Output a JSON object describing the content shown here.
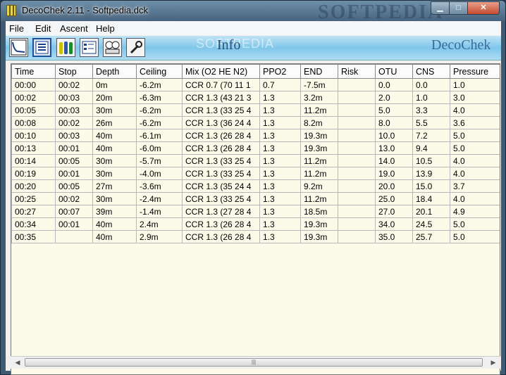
{
  "window": {
    "title": "DecoChek 2.11 - Softpedia.dck",
    "watermark": "SOFTPEDIA",
    "controls": {
      "minimize": "▁",
      "maximize": "□",
      "close": "✕"
    }
  },
  "menu": [
    "File",
    "Edit",
    "Ascent",
    "Help"
  ],
  "toolbar": {
    "tools": [
      {
        "icon": "profile-graph-icon",
        "active": false
      },
      {
        "icon": "table-list-icon",
        "active": true
      },
      {
        "icon": "tanks-icon",
        "active": false
      },
      {
        "icon": "form-icon",
        "active": false
      },
      {
        "icon": "gauges-icon",
        "active": false
      },
      {
        "icon": "wrench-icon",
        "active": false
      }
    ],
    "banner_label": "Info",
    "banner_watermark": "SOFTPEDIA",
    "brand": "DecoChek"
  },
  "table": {
    "columns": [
      "Time",
      "Stop",
      "Depth",
      "Ceiling",
      "Mix (O2 HE N2)",
      "PPO2",
      "END",
      "Risk",
      "OTU",
      "CNS",
      "Pressure"
    ],
    "rows": [
      [
        "00:00",
        "00:02",
        "0m",
        "-6.2m",
        "CCR 0.7 (70 11 1",
        "0.7",
        "-7.5m",
        "",
        "0.0",
        "0.0",
        "1.0"
      ],
      [
        "00:02",
        "00:03",
        "20m",
        "-6.3m",
        "CCR 1.3 (43 21 3",
        "1.3",
        "3.2m",
        "",
        "2.0",
        "1.0",
        "3.0"
      ],
      [
        "00:05",
        "00:03",
        "30m",
        "-6.2m",
        "CCR 1.3 (33 25 4",
        "1.3",
        "11.2m",
        "",
        "5.0",
        "3.3",
        "4.0"
      ],
      [
        "00:08",
        "00:02",
        "26m",
        "-6.2m",
        "CCR 1.3 (36 24 4",
        "1.3",
        "8.2m",
        "",
        "8.0",
        "5.5",
        "3.6"
      ],
      [
        "00:10",
        "00:03",
        "40m",
        "-6.1m",
        "CCR 1.3 (26 28 4",
        "1.3",
        "19.3m",
        "",
        "10.0",
        "7.2",
        "5.0"
      ],
      [
        "00:13",
        "00:01",
        "40m",
        "-6.0m",
        "CCR 1.3 (26 28 4",
        "1.3",
        "19.3m",
        "",
        "13.0",
        "9.4",
        "5.0"
      ],
      [
        "00:14",
        "00:05",
        "30m",
        "-5.7m",
        "CCR 1.3 (33 25 4",
        "1.3",
        "11.2m",
        "",
        "14.0",
        "10.5",
        "4.0"
      ],
      [
        "00:19",
        "00:01",
        "30m",
        "-4.0m",
        "CCR 1.3 (33 25 4",
        "1.3",
        "11.2m",
        "",
        "19.0",
        "13.9",
        "4.0"
      ],
      [
        "00:20",
        "00:05",
        "27m",
        "-3.6m",
        "CCR 1.3 (35 24 4",
        "1.3",
        "9.2m",
        "",
        "20.0",
        "15.0",
        "3.7"
      ],
      [
        "00:25",
        "00:02",
        "30m",
        "-2.4m",
        "CCR 1.3 (33 25 4",
        "1.3",
        "11.2m",
        "",
        "25.0",
        "18.4",
        "4.0"
      ],
      [
        "00:27",
        "00:07",
        "39m",
        "-1.4m",
        "CCR 1.3 (27 28 4",
        "1.3",
        "18.5m",
        "",
        "27.0",
        "20.1",
        "4.9"
      ],
      [
        "00:34",
        "00:01",
        "40m",
        "2.4m",
        "CCR 1.3 (26 28 4",
        "1.3",
        "19.3m",
        "",
        "34.0",
        "24.5",
        "5.0"
      ],
      [
        "00:35",
        "",
        "40m",
        "2.9m",
        "CCR 1.3 (26 28 4",
        "1.3",
        "19.3m",
        "",
        "35.0",
        "25.7",
        "5.0"
      ]
    ]
  },
  "scrollbar": {
    "left": "◀",
    "right": "▶",
    "grip": "|||"
  }
}
